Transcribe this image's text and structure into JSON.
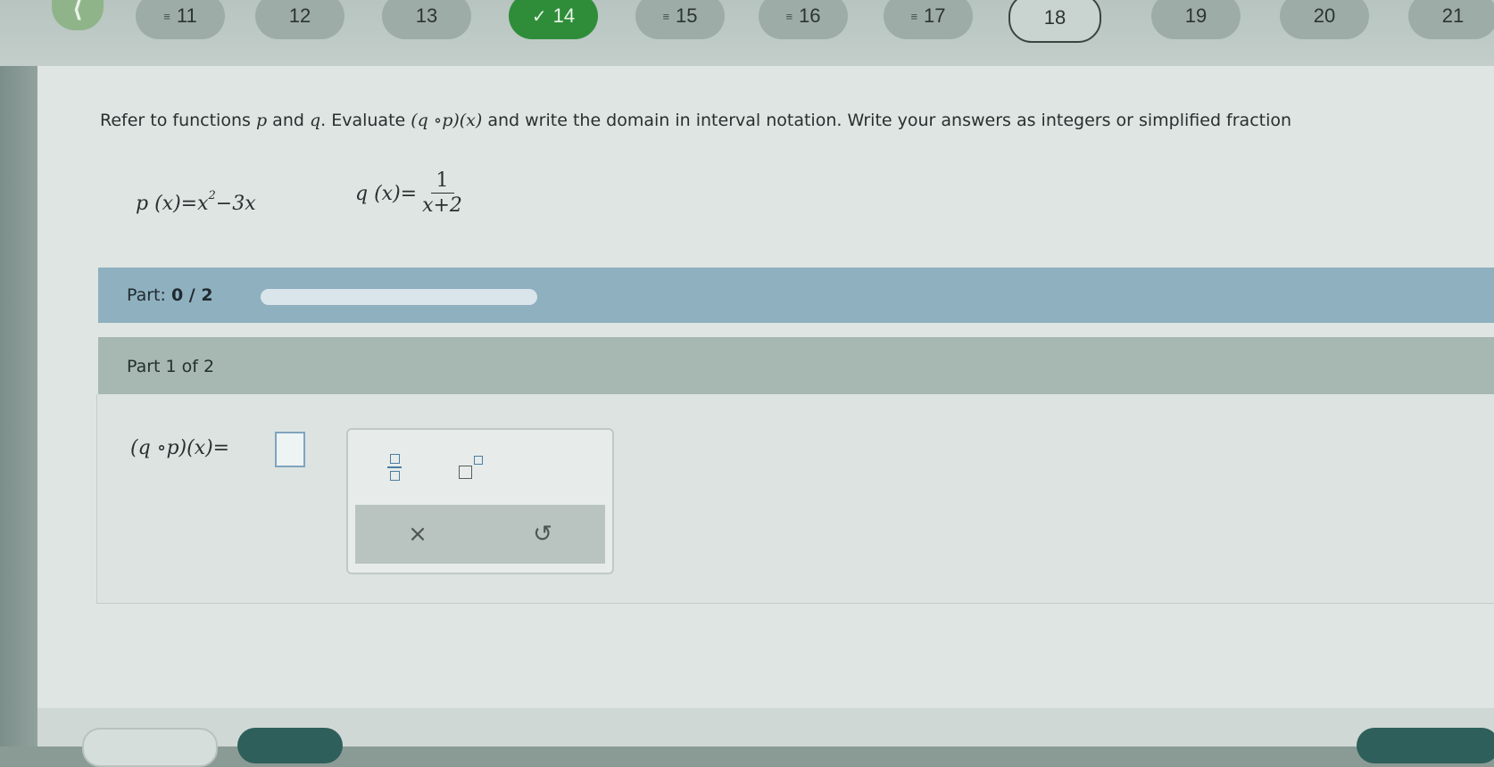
{
  "nav": {
    "back_glyph": "⟨",
    "questions": [
      {
        "number": "11",
        "mark": "≡",
        "state": "answered"
      },
      {
        "number": "12",
        "mark": "",
        "state": "unanswered"
      },
      {
        "number": "13",
        "mark": "",
        "state": "unanswered"
      },
      {
        "number": "14",
        "mark": "✓",
        "state": "done"
      },
      {
        "number": "15",
        "mark": "≡",
        "state": "answered"
      },
      {
        "number": "16",
        "mark": "≡",
        "state": "answered"
      },
      {
        "number": "17",
        "mark": "≡",
        "state": "answered"
      },
      {
        "number": "18",
        "mark": "",
        "state": "current"
      },
      {
        "number": "19",
        "mark": "",
        "state": "unanswered"
      },
      {
        "number": "20",
        "mark": "",
        "state": "unanswered"
      },
      {
        "number": "21",
        "mark": "",
        "state": "unanswered"
      }
    ]
  },
  "problem": {
    "prompt_before": "Refer to functions",
    "prompt_p": "p",
    "prompt_and": "and",
    "prompt_q": "q",
    "prompt_evaluate": ". Evaluate",
    "prompt_comp": "(q ∘p)(x)",
    "prompt_after": "and write the domain in interval notation. Write your answers as integers or simplified fraction",
    "p_def": "p (x)=x",
    "p_exp": "2",
    "p_tail": "−3x",
    "q_lhs": "q (x)=",
    "q_num": "1",
    "q_den": "x+2"
  },
  "part_progress": {
    "label": "Part:",
    "value": "0 / 2",
    "fraction_complete": 0.0
  },
  "part1": {
    "heading": "Part 1 of 2",
    "expression": "(q ∘p)(x)=",
    "answer_value": ""
  },
  "palette": {
    "clear_glyph": "×",
    "undo_glyph": "↺"
  },
  "colors": {
    "done_green": "#2f8d3a",
    "part_bar": "#8fb0bf",
    "input_border": "#7fa4bf"
  }
}
